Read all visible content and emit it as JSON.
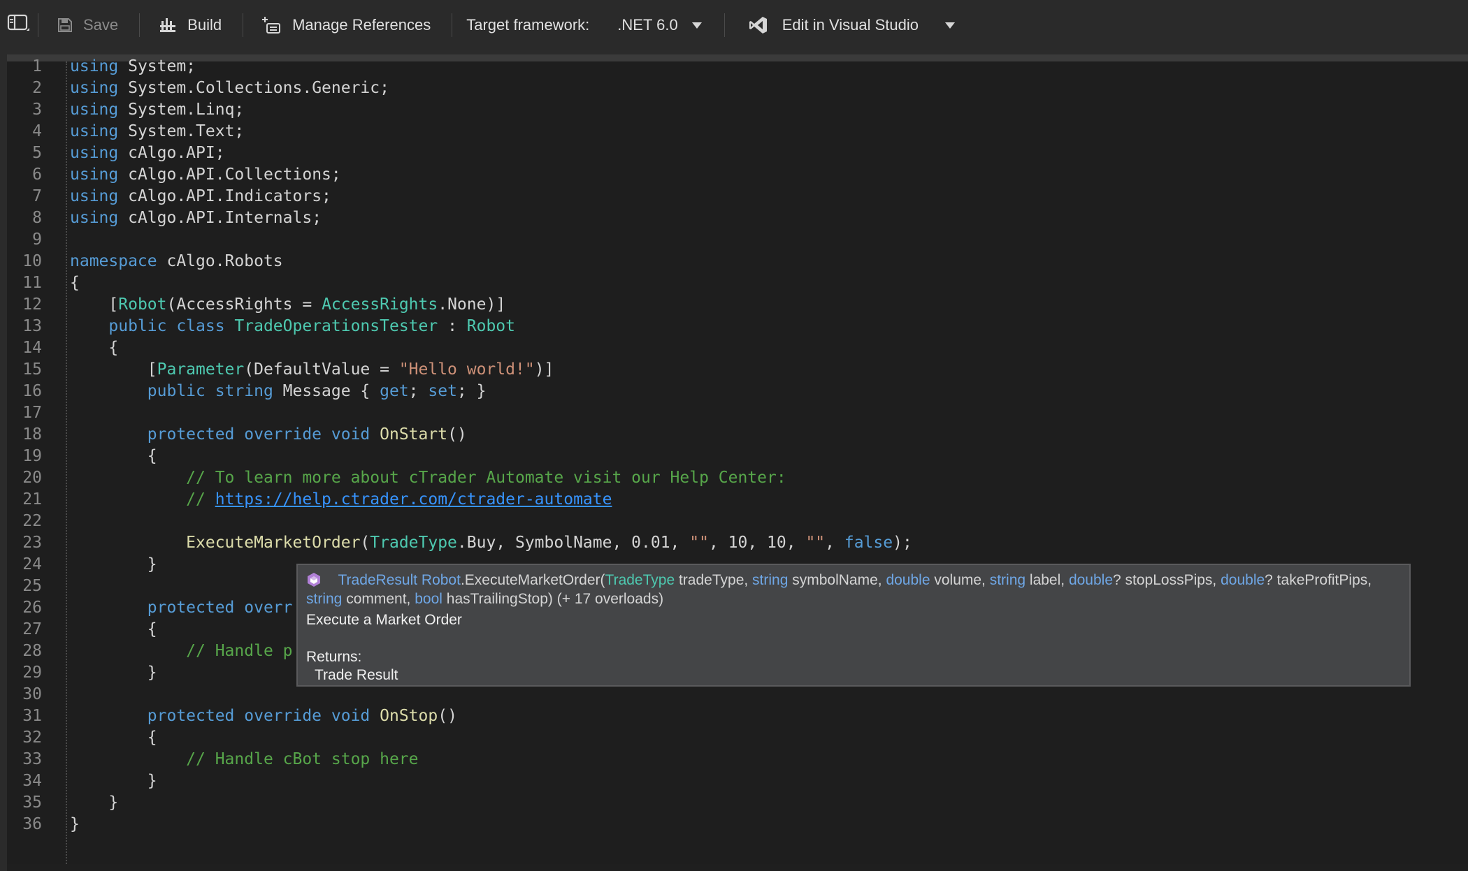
{
  "toolbar": {
    "save_label": "Save",
    "build_label": "Build",
    "manage_refs_label": "Manage References",
    "target_framework_label": "Target framework:",
    "target_framework_value": ".NET 6.0",
    "edit_vs_label": "Edit in Visual Studio"
  },
  "code": {
    "lines": [
      {
        "n": "1",
        "parts": [
          [
            "kw",
            "using"
          ],
          [
            "tx",
            " System;"
          ]
        ]
      },
      {
        "n": "2",
        "parts": [
          [
            "kw",
            "using"
          ],
          [
            "tx",
            " System.Collections.Generic;"
          ]
        ]
      },
      {
        "n": "3",
        "parts": [
          [
            "kw",
            "using"
          ],
          [
            "tx",
            " System.Linq;"
          ]
        ]
      },
      {
        "n": "4",
        "parts": [
          [
            "kw",
            "using"
          ],
          [
            "tx",
            " System.Text;"
          ]
        ]
      },
      {
        "n": "5",
        "parts": [
          [
            "kw",
            "using"
          ],
          [
            "tx",
            " cAlgo.API;"
          ]
        ]
      },
      {
        "n": "6",
        "parts": [
          [
            "kw",
            "using"
          ],
          [
            "tx",
            " cAlgo.API.Collections;"
          ]
        ]
      },
      {
        "n": "7",
        "parts": [
          [
            "kw",
            "using"
          ],
          [
            "tx",
            " cAlgo.API.Indicators;"
          ]
        ]
      },
      {
        "n": "8",
        "parts": [
          [
            "kw",
            "using"
          ],
          [
            "tx",
            " cAlgo.API.Internals;"
          ]
        ]
      },
      {
        "n": "9",
        "parts": []
      },
      {
        "n": "10",
        "parts": [
          [
            "kw",
            "namespace"
          ],
          [
            "tx",
            " cAlgo.Robots"
          ]
        ]
      },
      {
        "n": "11",
        "parts": [
          [
            "tx",
            "{"
          ]
        ]
      },
      {
        "n": "12",
        "parts": [
          [
            "tx",
            "    ["
          ],
          [
            "ty",
            "Robot"
          ],
          [
            "tx",
            "(AccessRights = "
          ],
          [
            "ty",
            "AccessRights"
          ],
          [
            "tx",
            ".None)]"
          ]
        ]
      },
      {
        "n": "13",
        "parts": [
          [
            "tx",
            "    "
          ],
          [
            "kw",
            "public class"
          ],
          [
            "tx",
            " "
          ],
          [
            "ty",
            "TradeOperationsTester"
          ],
          [
            "tx",
            " : "
          ],
          [
            "ty",
            "Robot"
          ]
        ]
      },
      {
        "n": "14",
        "parts": [
          [
            "tx",
            "    {"
          ]
        ]
      },
      {
        "n": "15",
        "parts": [
          [
            "tx",
            "        ["
          ],
          [
            "ty",
            "Parameter"
          ],
          [
            "tx",
            "(DefaultValue = "
          ],
          [
            "st",
            "\"Hello world!\""
          ],
          [
            "tx",
            ")]"
          ]
        ]
      },
      {
        "n": "16",
        "parts": [
          [
            "tx",
            "        "
          ],
          [
            "kw",
            "public string"
          ],
          [
            "tx",
            " Message { "
          ],
          [
            "kw",
            "get"
          ],
          [
            "tx",
            "; "
          ],
          [
            "kw",
            "set"
          ],
          [
            "tx",
            "; }"
          ]
        ]
      },
      {
        "n": "17",
        "parts": []
      },
      {
        "n": "18",
        "parts": [
          [
            "tx",
            "        "
          ],
          [
            "kw",
            "protected override void"
          ],
          [
            "tx",
            " "
          ],
          [
            "fn",
            "OnStart"
          ],
          [
            "tx",
            "()"
          ]
        ]
      },
      {
        "n": "19",
        "parts": [
          [
            "tx",
            "        {"
          ]
        ]
      },
      {
        "n": "20",
        "parts": [
          [
            "tx",
            "            "
          ],
          [
            "cm",
            "// To learn more about cTrader Automate visit our Help Center:"
          ]
        ]
      },
      {
        "n": "21",
        "parts": [
          [
            "tx",
            "            "
          ],
          [
            "cm",
            "// "
          ],
          [
            "lk",
            "https://help.ctrader.com/ctrader-automate"
          ]
        ]
      },
      {
        "n": "22",
        "parts": []
      },
      {
        "n": "23",
        "parts": [
          [
            "tx",
            "            "
          ],
          [
            "fn",
            "ExecuteMarketOrder"
          ],
          [
            "tx",
            "("
          ],
          [
            "ty",
            "TradeType"
          ],
          [
            "tx",
            ".Buy, SymbolName, 0.01, "
          ],
          [
            "st",
            "\"\""
          ],
          [
            "tx",
            ", 10, 10, "
          ],
          [
            "st",
            "\"\""
          ],
          [
            "tx",
            ", "
          ],
          [
            "kw",
            "false"
          ],
          [
            "tx",
            ");"
          ]
        ]
      },
      {
        "n": "24",
        "parts": [
          [
            "tx",
            "        }"
          ]
        ]
      },
      {
        "n": "25",
        "parts": []
      },
      {
        "n": "26",
        "parts": [
          [
            "tx",
            "        "
          ],
          [
            "kw",
            "protected overr"
          ]
        ]
      },
      {
        "n": "27",
        "parts": [
          [
            "tx",
            "        {"
          ]
        ]
      },
      {
        "n": "28",
        "parts": [
          [
            "tx",
            "            "
          ],
          [
            "cm",
            "// Handle p"
          ]
        ]
      },
      {
        "n": "29",
        "parts": [
          [
            "tx",
            "        }"
          ]
        ]
      },
      {
        "n": "30",
        "parts": []
      },
      {
        "n": "31",
        "parts": [
          [
            "tx",
            "        "
          ],
          [
            "kw",
            "protected override void"
          ],
          [
            "tx",
            " "
          ],
          [
            "fn",
            "OnStop"
          ],
          [
            "tx",
            "()"
          ]
        ]
      },
      {
        "n": "32",
        "parts": [
          [
            "tx",
            "        {"
          ]
        ]
      },
      {
        "n": "33",
        "parts": [
          [
            "tx",
            "            "
          ],
          [
            "cm",
            "// Handle cBot stop here"
          ]
        ]
      },
      {
        "n": "34",
        "parts": [
          [
            "tx",
            "        }"
          ]
        ]
      },
      {
        "n": "35",
        "parts": [
          [
            "tx",
            "    }"
          ]
        ]
      },
      {
        "n": "36",
        "parts": [
          [
            "tx",
            "}"
          ]
        ]
      }
    ]
  },
  "tooltip": {
    "signature_parts": [
      [
        "kw",
        "TradeResult Robot"
      ],
      [
        "tx",
        ".ExecuteMarketOrder("
      ],
      [
        "ty",
        "TradeType"
      ],
      [
        "tx",
        " tradeType, "
      ],
      [
        "kw",
        "string"
      ],
      [
        "tx",
        " symbolName, "
      ],
      [
        "kw",
        "double"
      ],
      [
        "tx",
        " volume, "
      ],
      [
        "kw",
        "string"
      ],
      [
        "tx",
        " label, "
      ],
      [
        "kw",
        "double"
      ],
      [
        "tx",
        "? stopLossPips, "
      ],
      [
        "kw",
        "double"
      ],
      [
        "tx",
        "? takeProfitPips, "
      ],
      [
        "kw",
        "string"
      ],
      [
        "tx",
        " comment, "
      ],
      [
        "kw",
        "bool"
      ],
      [
        "tx",
        " hasTrailingStop) (+ 17 overloads)"
      ]
    ],
    "description": "Execute a Market Order",
    "returns_label": "Returns:",
    "returns_value": "Trade Result"
  }
}
